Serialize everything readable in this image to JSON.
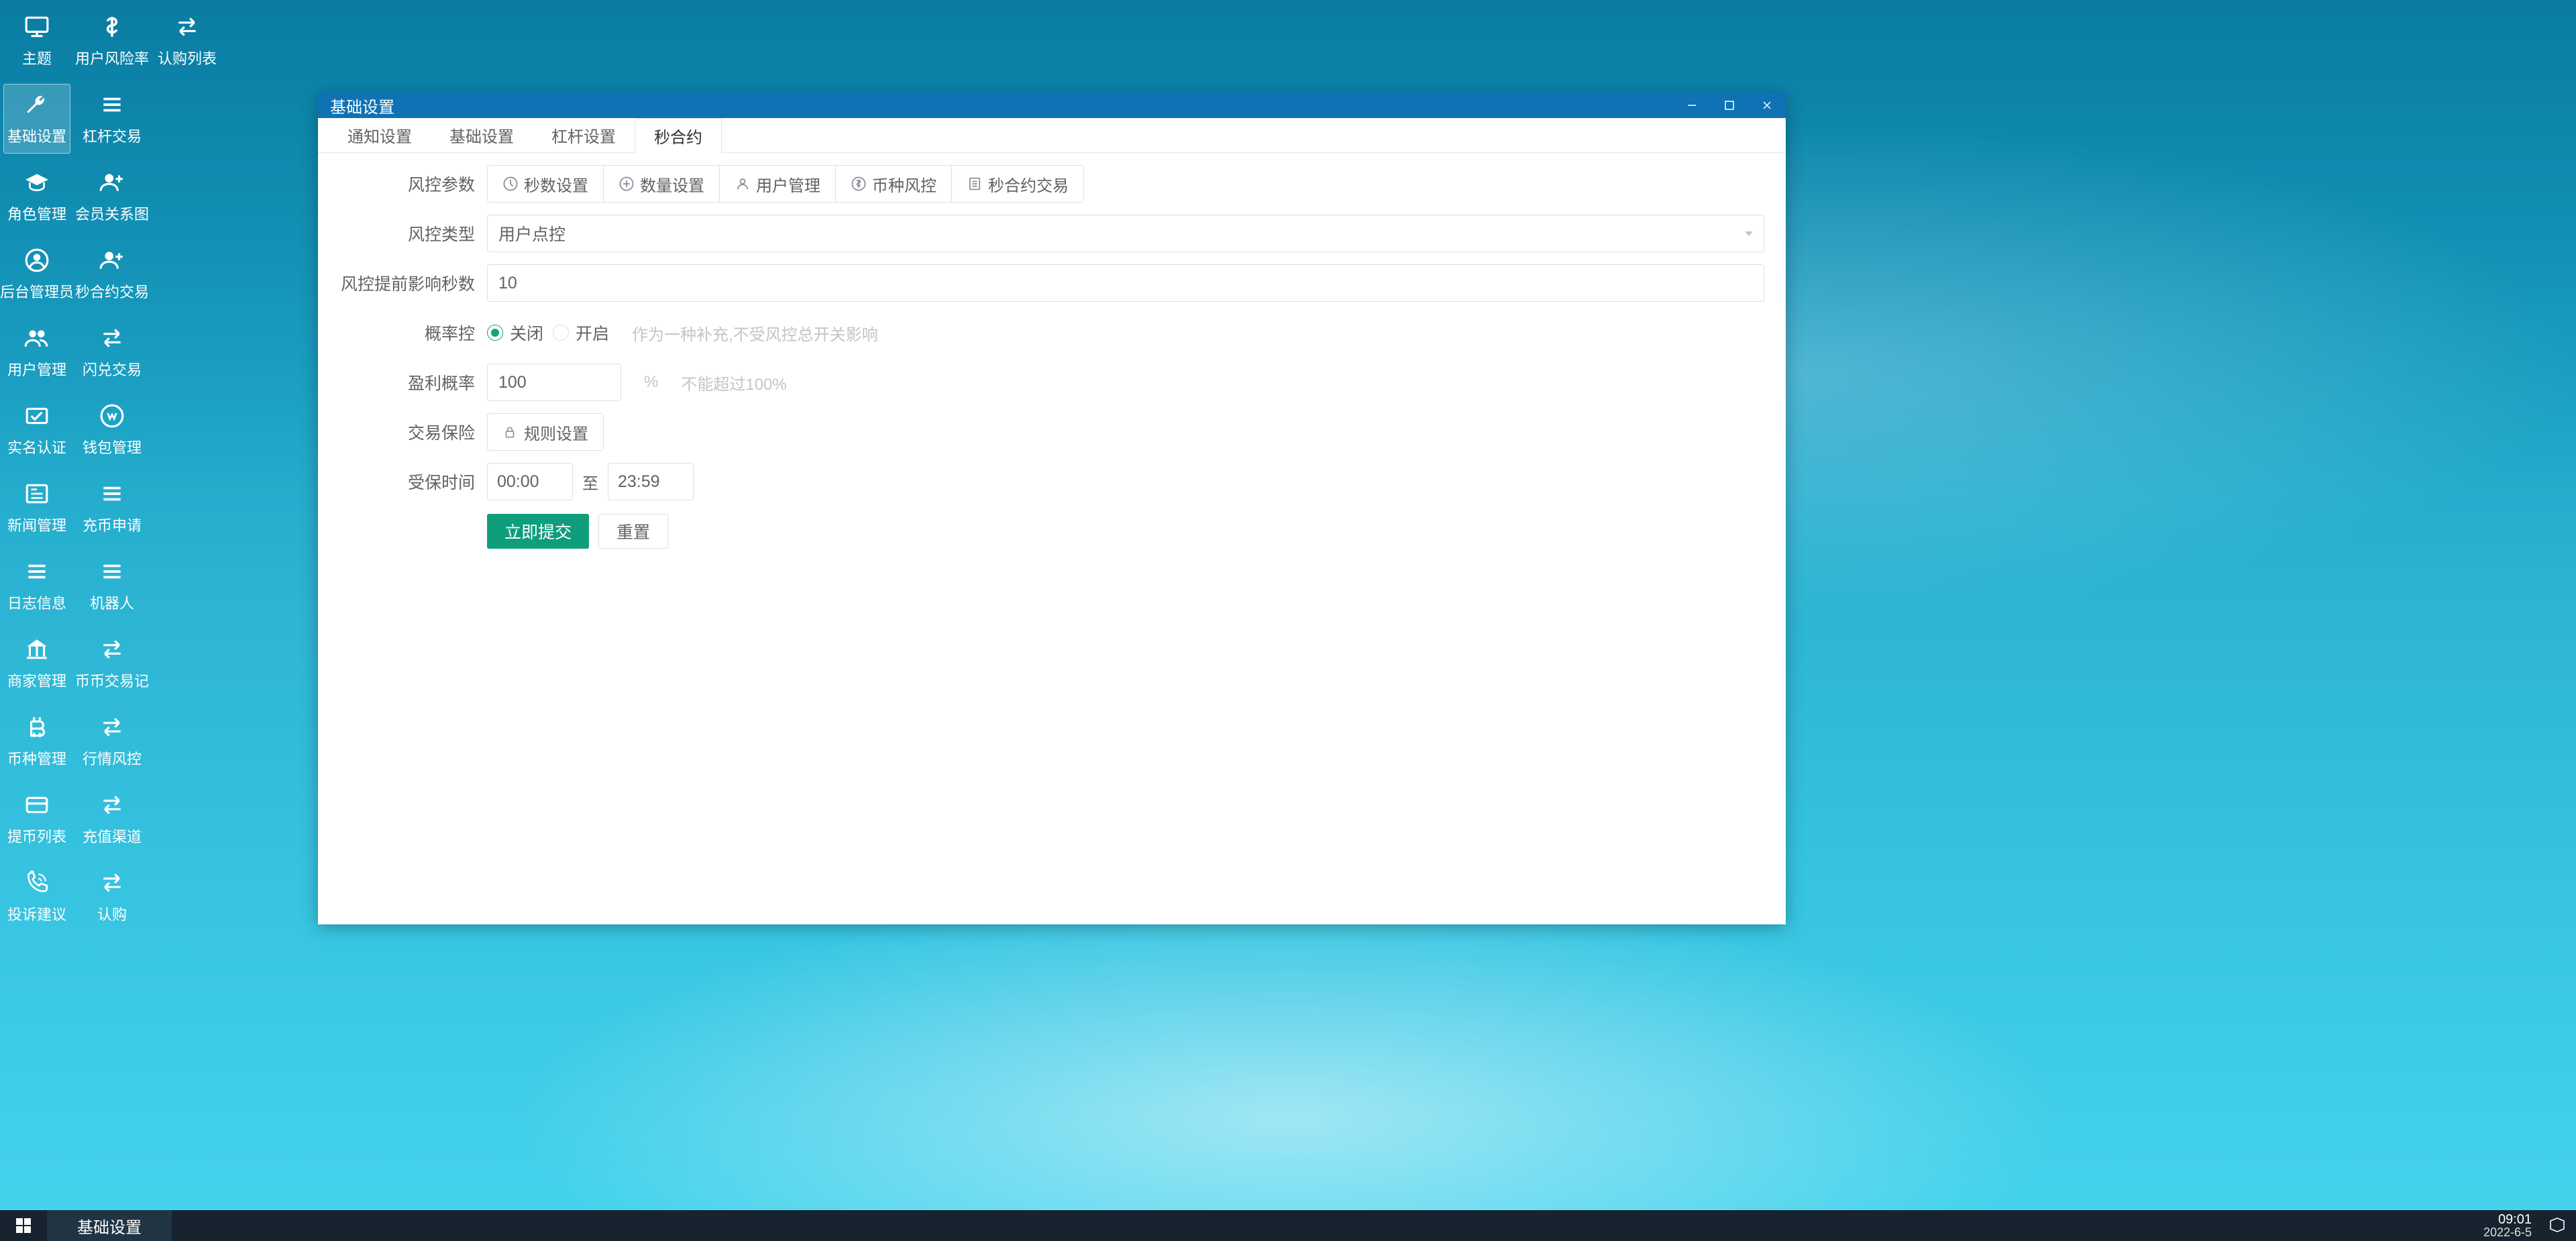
{
  "desktop": {
    "col1": [
      {
        "name": "theme",
        "label": "主题",
        "icon": "monitor"
      },
      {
        "name": "basic-settings",
        "label": "基础设置",
        "icon": "wrench",
        "active": true
      },
      {
        "name": "role-mgmt",
        "label": "角色管理",
        "icon": "grad-cap"
      },
      {
        "name": "backend-admin",
        "label": "后台管理员",
        "icon": "user-circle"
      },
      {
        "name": "user-mgmt",
        "label": "用户管理",
        "icon": "users"
      },
      {
        "name": "real-name",
        "label": "实名认证",
        "icon": "check"
      },
      {
        "name": "news-mgmt",
        "label": "新闻管理",
        "icon": "news"
      },
      {
        "name": "log-info",
        "label": "日志信息",
        "icon": "list"
      },
      {
        "name": "merchant-mgmt",
        "label": "商家管理",
        "icon": "bank"
      },
      {
        "name": "coin-mgmt",
        "label": "币种管理",
        "icon": "btc"
      },
      {
        "name": "withdraw-list",
        "label": "提币列表",
        "icon": "card"
      },
      {
        "name": "complaint",
        "label": "投诉建议",
        "icon": "phone"
      }
    ],
    "col2": [
      {
        "name": "user-risk-rate",
        "label": "用户风险率",
        "icon": "dollar"
      },
      {
        "name": "lever-trade",
        "label": "杠杆交易",
        "icon": "list"
      },
      {
        "name": "member-relation",
        "label": "会员关系图",
        "icon": "user-plus"
      },
      {
        "name": "sec-contract-trade",
        "label": "秒合约交易",
        "icon": "user-plus"
      },
      {
        "name": "flash-trade",
        "label": "闪兑交易",
        "icon": "swap"
      },
      {
        "name": "wallet-mgmt",
        "label": "钱包管理",
        "icon": "wallet"
      },
      {
        "name": "deposit-apply",
        "label": "充币申请",
        "icon": "list"
      },
      {
        "name": "robot",
        "label": "机器人",
        "icon": "list"
      },
      {
        "name": "coin-trade-log",
        "label": "币币交易记",
        "icon": "swap"
      },
      {
        "name": "quote-risk",
        "label": "行情风控",
        "icon": "swap"
      },
      {
        "name": "deposit-channel",
        "label": "充值渠道",
        "icon": "swap"
      },
      {
        "name": "subscribe",
        "label": "认购",
        "icon": "swap"
      }
    ],
    "col1_top2": {
      "name": "subscribe-list",
      "label": "认购列表",
      "icon": "swap"
    }
  },
  "window": {
    "title": "基础设置",
    "tabs": [
      {
        "name": "notify",
        "label": "通知设置"
      },
      {
        "name": "basic",
        "label": "基础设置"
      },
      {
        "name": "lever",
        "label": "杠杆设置"
      },
      {
        "name": "sec-contract",
        "label": "秒合约",
        "active": true
      }
    ],
    "form": {
      "risk_param_label": "风控参数",
      "sub_tabs": [
        {
          "name": "seconds",
          "label": "秒数设置",
          "icon": "clock"
        },
        {
          "name": "quantity",
          "label": "数量设置",
          "icon": "plus-circle"
        },
        {
          "name": "user",
          "label": "用户管理",
          "icon": "person"
        },
        {
          "name": "coin",
          "label": "币种风控",
          "icon": "dollar-circle"
        },
        {
          "name": "sec-trade",
          "label": "秒合约交易",
          "icon": "doc"
        }
      ],
      "risk_type_label": "风控类型",
      "risk_type_value": "用户点控",
      "pre_seconds_label": "风控提前影响秒数",
      "pre_seconds_value": "10",
      "prob_label": "概率控",
      "prob_off": "关闭",
      "prob_on": "开启",
      "prob_hint": "作为一种补充,不受风控总开关影响",
      "profit_label": "盈利概率",
      "profit_value": "100",
      "profit_unit": "%",
      "profit_hint": "不能超过100%",
      "insurance_label": "交易保险",
      "rule_btn": "规则设置",
      "insured_time_label": "受保时间",
      "time_from": "00:00",
      "time_sep": "至",
      "time_to": "23:59",
      "submit": "立即提交",
      "reset": "重置"
    }
  },
  "taskbar": {
    "item": "基础设置",
    "time": "09:01",
    "date": "2022-6-5"
  }
}
